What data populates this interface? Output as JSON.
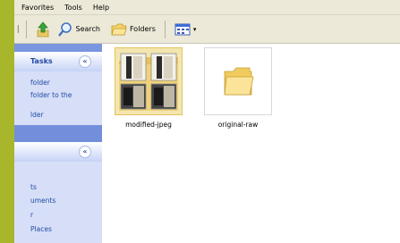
{
  "menubar": {
    "items": [
      "Favorites",
      "Tools",
      "Help"
    ]
  },
  "toolbar": {
    "fragment": "",
    "search_label": "Search",
    "folders_label": "Folders",
    "views_icon": "views-icon"
  },
  "sidebar": {
    "tasks_panel": {
      "title": "Tasks",
      "links": [
        "folder",
        "folder to the",
        "lder"
      ]
    },
    "places_panel": {
      "links": [
        "ts",
        "uments",
        "r",
        "Places"
      ]
    }
  },
  "content": {
    "items": [
      {
        "name": "modified-jpeg",
        "selected": true
      },
      {
        "name": "original-raw",
        "selected": false
      }
    ]
  },
  "colors": {
    "strip": "#a7b62b",
    "sidebar": "#6b85d6",
    "selection": "#f3e6b0"
  }
}
